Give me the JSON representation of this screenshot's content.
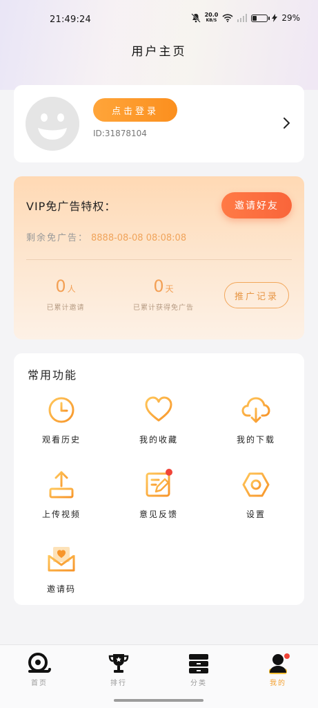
{
  "status_bar": {
    "time": "21:49:24",
    "net_speed": "20.0",
    "net_unit": "KB/S",
    "battery": "29%",
    "battery_level": 0.29
  },
  "page_title": "用户主页",
  "user": {
    "login_label": "点击登录",
    "id_text": "ID:31878104"
  },
  "vip": {
    "title": "VIP免广告特权：",
    "invite_label": "邀请好友",
    "remain_label": "剩余免广告：",
    "remain_value": "8888-08-08 08:08:08",
    "stats": [
      {
        "value": "0",
        "unit": "人",
        "label": "已累计邀请"
      },
      {
        "value": "0",
        "unit": "天",
        "label": "已累计获得免广告"
      }
    ],
    "promo_label": "推广记录"
  },
  "functions": {
    "title": "常用功能",
    "items": [
      {
        "label": "观看历史",
        "icon": "clock-icon"
      },
      {
        "label": "我的收藏",
        "icon": "heart-icon"
      },
      {
        "label": "我的下载",
        "icon": "cloud-download-icon"
      },
      {
        "label": "上传视频",
        "icon": "upload-icon"
      },
      {
        "label": "意见反馈",
        "icon": "edit-note-icon"
      },
      {
        "label": "设置",
        "icon": "hexagon-settings-icon"
      },
      {
        "label": "邀请码",
        "icon": "envelope-heart-icon"
      }
    ]
  },
  "tabbar": {
    "items": [
      {
        "label": "首页",
        "icon": "home-snail-icon"
      },
      {
        "label": "排行",
        "icon": "trophy-icon"
      },
      {
        "label": "分类",
        "icon": "category-box-icon"
      },
      {
        "label": "我的",
        "icon": "user-icon",
        "active": true
      }
    ]
  },
  "colors": {
    "accent": "#f4a233",
    "orange_button": "#fb8f1e",
    "invite_button": "#f9653a",
    "badge": "#f04438"
  }
}
